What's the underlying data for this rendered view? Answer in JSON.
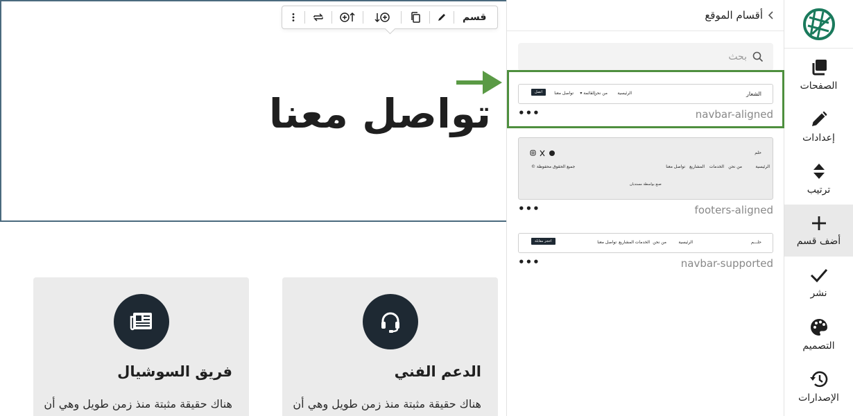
{
  "canvas": {
    "hero_title": "تواصل معنا",
    "toolbar": {
      "section_label": "قسم",
      "icons": [
        "edit-icon",
        "duplicate-icon",
        "insert-below-icon",
        "insert-above-icon",
        "replace-icon",
        "more-vertical-icon"
      ]
    },
    "cards": [
      {
        "icon": "headset-icon",
        "title": "الدعم الفني",
        "text": "هناك حقيقة مثبتة منذ زمن طويل وهي أن"
      },
      {
        "icon": "newspaper-icon",
        "title": "فريق السوشيال",
        "text": "هناك حقيقة مثبتة منذ زمن طويل وهي أن"
      }
    ]
  },
  "panel": {
    "title": "أقسام الموقع",
    "search_placeholder": "بحث",
    "patterns": [
      {
        "name": "navbar-aligned",
        "preview": {
          "brand": "الشعار",
          "links": [
            "الرئيسية",
            "من نحن",
            "القائمة ▾",
            "تواصل معنا"
          ],
          "button": "اتصل"
        }
      },
      {
        "name": "footers-aligned",
        "preview": {
          "brand": "حلم",
          "links": [
            "الرئيسية",
            "من نحن",
            "الخدمات",
            "المشاريع",
            "تواصل معنا"
          ],
          "rights": "جميع الحقوق محفوظة ©",
          "credit": "صنع بواسطة مستديان",
          "social_icons": [
            "facebook-icon",
            "x-icon",
            "instagram-icon"
          ]
        }
      },
      {
        "name": "navbar-supported",
        "preview": {
          "brand": "حلـــم",
          "links": [
            "الرئيسية",
            "من نحن",
            "الخدمات",
            "المشاريع",
            "تواصل معنا"
          ],
          "button": "احجز مقابلة"
        }
      }
    ]
  },
  "rail": {
    "items": [
      {
        "label": "الصفحات",
        "icon": "pages-icon"
      },
      {
        "label": "إعدادات",
        "icon": "pencil-icon"
      },
      {
        "label": "ترتيب",
        "icon": "sort-icon"
      },
      {
        "label": "أضف قسم",
        "icon": "plus-icon",
        "active": true
      },
      {
        "label": "نشر",
        "icon": "check-icon"
      },
      {
        "label": "التصميم",
        "icon": "palette-icon"
      },
      {
        "label": "الإصدارات",
        "icon": "history-icon"
      }
    ]
  },
  "colors": {
    "accent_dark": "#1e2933",
    "highlight_green": "#4e8f3e",
    "arrow_green": "#5a9a45",
    "selection_border": "#4a6a7e",
    "logo_green": "#1a7a5c"
  }
}
